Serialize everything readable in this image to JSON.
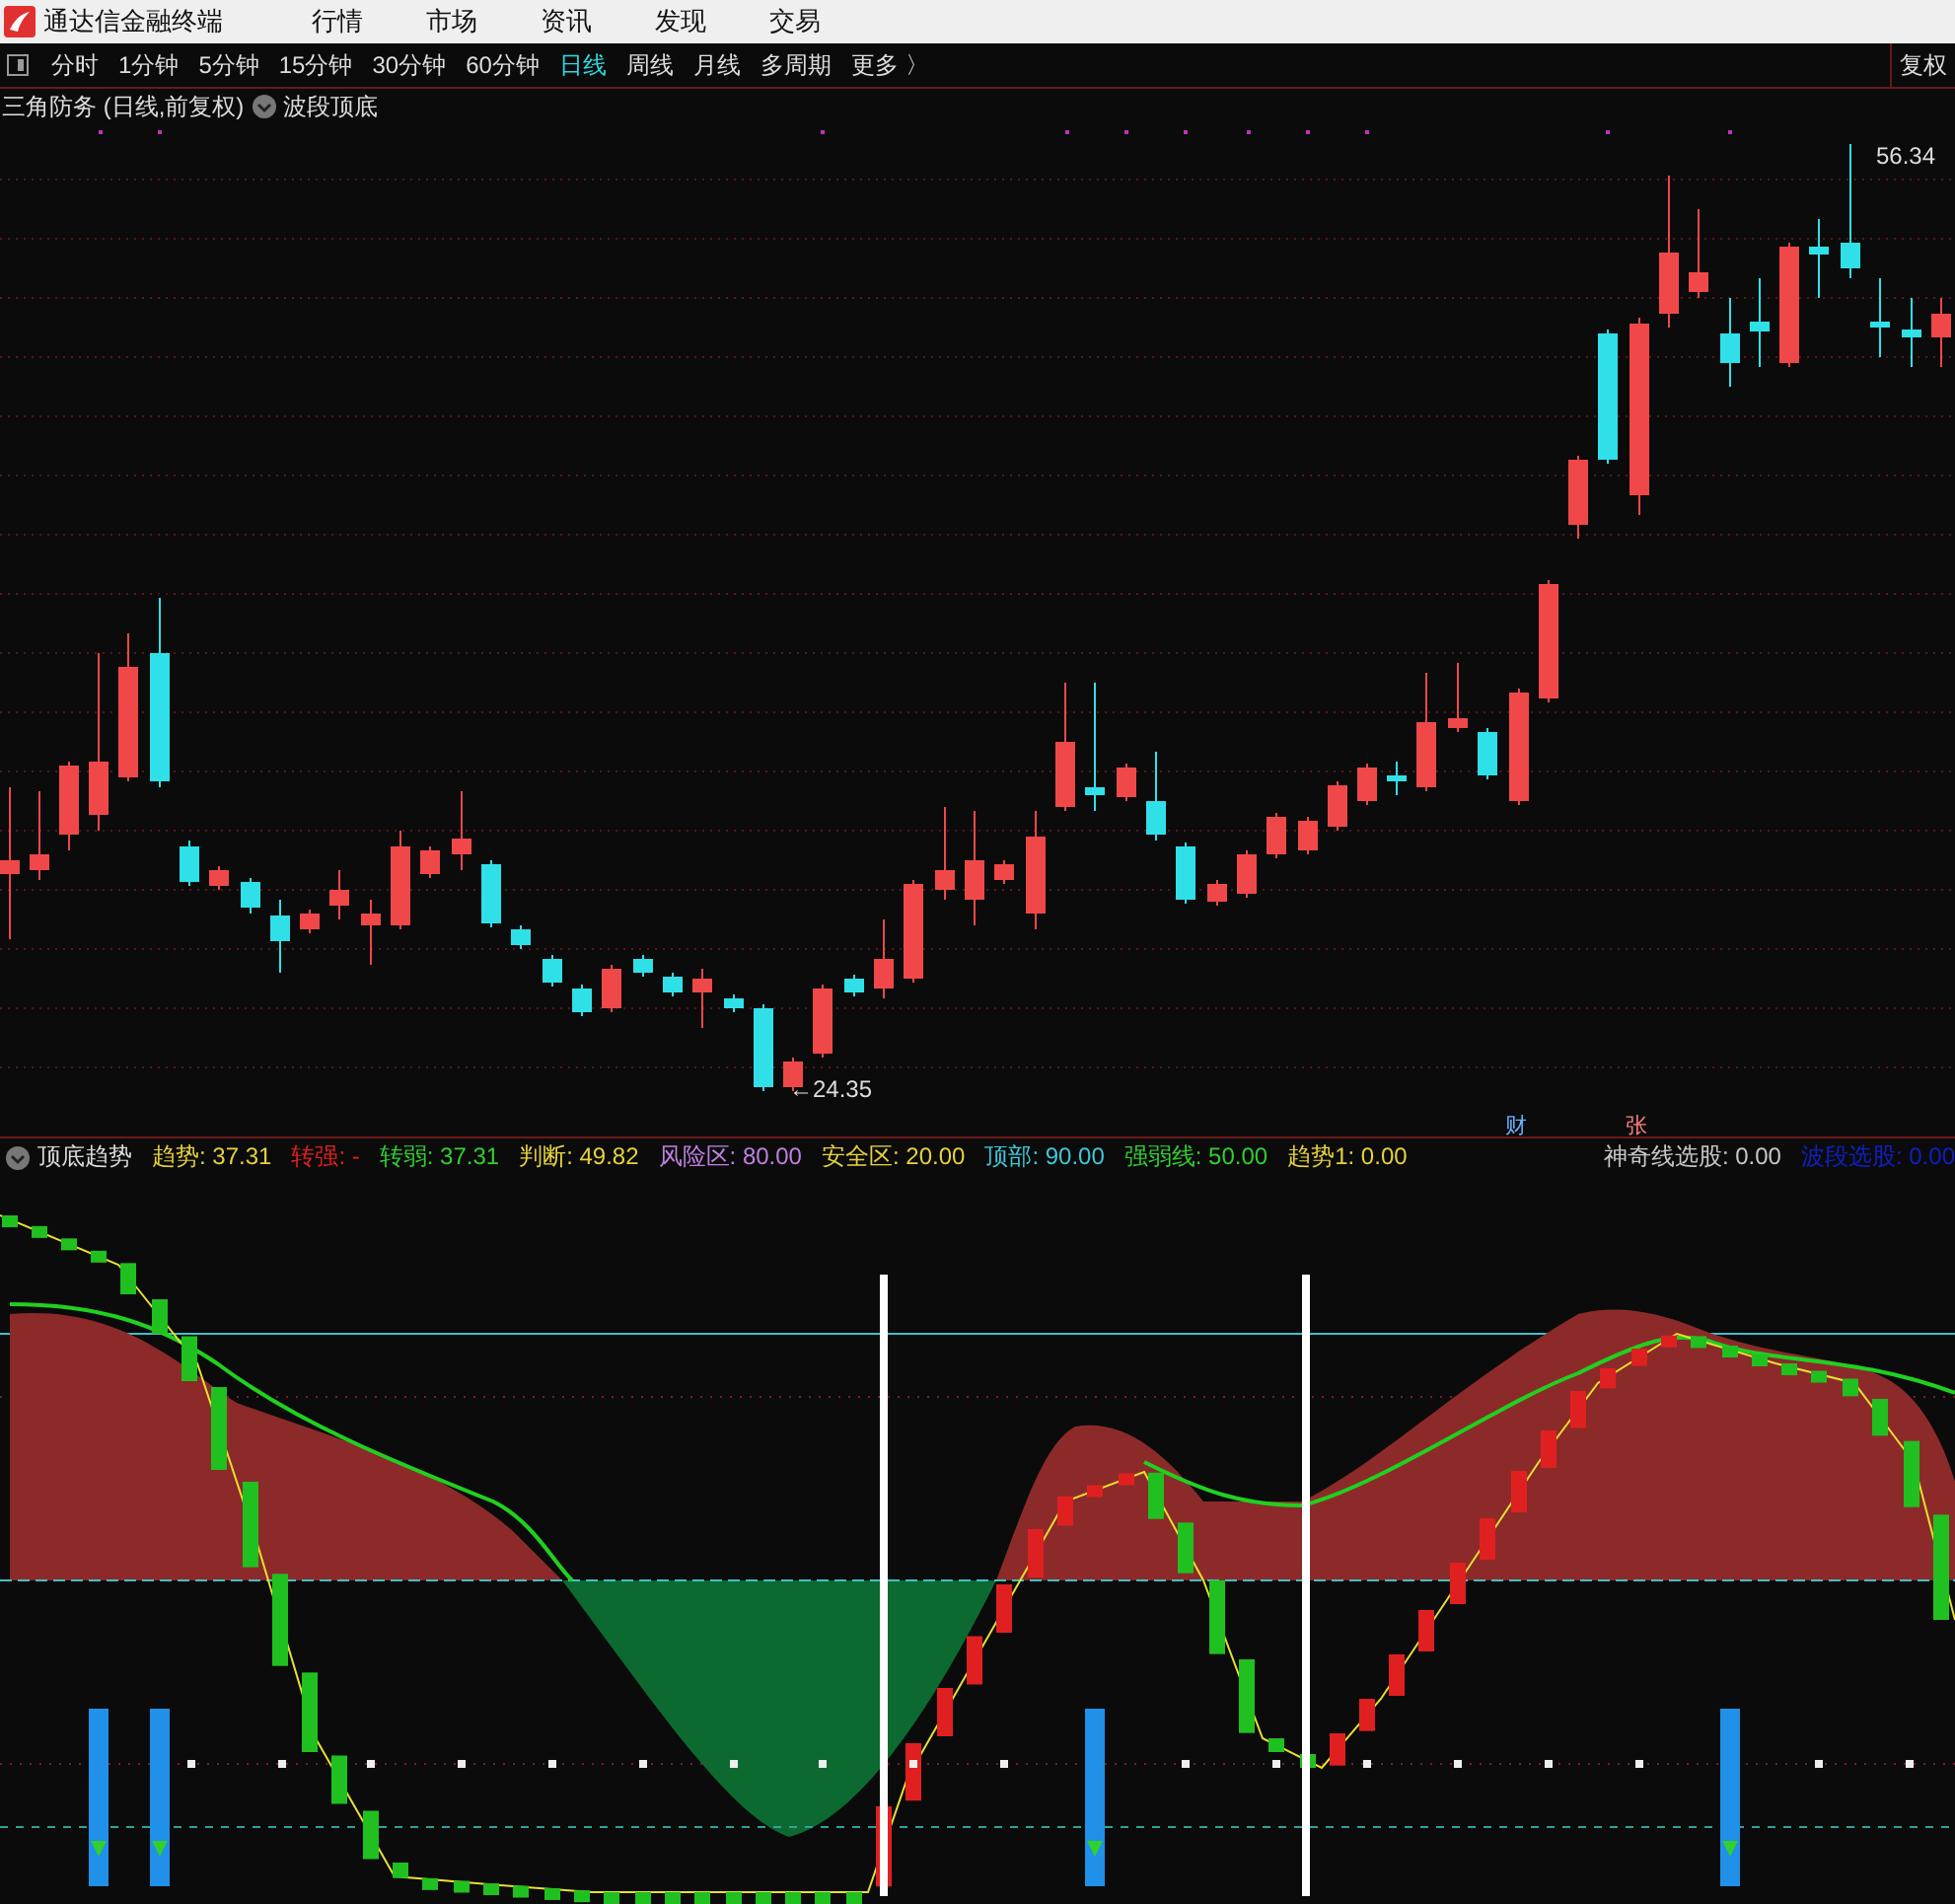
{
  "window": {
    "title": "通达信金融终端"
  },
  "menu": [
    "行情",
    "市场",
    "资讯",
    "发现",
    "交易"
  ],
  "periods": [
    {
      "label": "分时",
      "selected": false
    },
    {
      "label": "1分钟",
      "selected": false
    },
    {
      "label": "5分钟",
      "selected": false
    },
    {
      "label": "15分钟",
      "selected": false
    },
    {
      "label": "30分钟",
      "selected": false
    },
    {
      "label": "60分钟",
      "selected": false
    },
    {
      "label": "日线",
      "selected": true
    },
    {
      "label": "周线",
      "selected": false
    },
    {
      "label": "月线",
      "selected": false
    },
    {
      "label": "多周期",
      "selected": false
    },
    {
      "label": "更多 〉",
      "selected": false
    }
  ],
  "adjust_button": "复权",
  "chart": {
    "title": "三角防务 (日线,前复权)",
    "indicator": "波段顶底",
    "high_label": "56.34",
    "low_label": "←24.35",
    "markers": [
      "财",
      "张"
    ]
  },
  "indicator_panel": {
    "name": "顶底趋势",
    "items": [
      {
        "label": "趋势:",
        "value": "37.31",
        "color": "#e6d23c"
      },
      {
        "label": "转强:",
        "value": "-",
        "color": "#e02020"
      },
      {
        "label": "转弱:",
        "value": "37.31",
        "color": "#30d030"
      },
      {
        "label": "判断:",
        "value": "49.82",
        "color": "#e6d23c"
      },
      {
        "label": "风险区:",
        "value": "80.00",
        "color": "#c080e0"
      },
      {
        "label": "安全区:",
        "value": "20.00",
        "color": "#e6d23c"
      },
      {
        "label": "顶部:",
        "value": "90.00",
        "color": "#40c8d8"
      },
      {
        "label": "强弱线:",
        "value": "50.00",
        "color": "#30d030"
      },
      {
        "label": "趋势1:",
        "value": "0.00",
        "color": "#e6d23c"
      },
      {
        "label": "神奇线选股:",
        "value": "0.00",
        "color": "#c8c8c8"
      },
      {
        "label": "波段选股:",
        "value": "0.00",
        "color": "#1020c0"
      }
    ]
  }
}
